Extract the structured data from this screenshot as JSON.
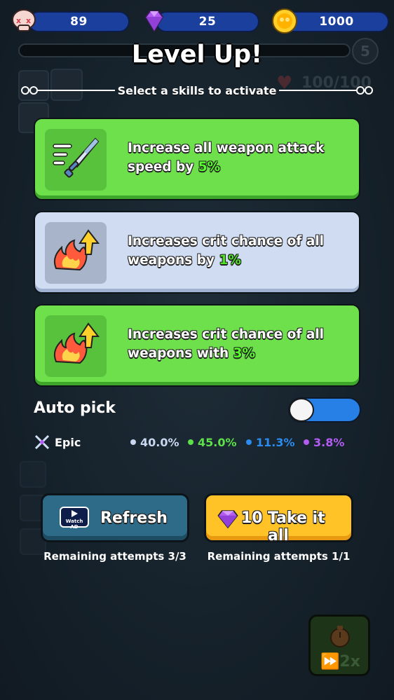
{
  "hud": {
    "kills": "89",
    "gems": "25",
    "coins": "1000",
    "level": "5",
    "hp": "100/100"
  },
  "dialog": {
    "title": "Level Up!",
    "subtitle": "Select a skills to activate"
  },
  "skills": [
    {
      "line1": "Increase all weapon attack",
      "line2_pre": "speed by ",
      "value": "5%",
      "line2_post": "",
      "style": "green",
      "icon": "sword-speed-icon"
    },
    {
      "line1": "Increases crit chance of all",
      "line2_pre": "weapons by ",
      "value": "1%",
      "line2_post": "",
      "style": "blue",
      "icon": "crit-fire-icon"
    },
    {
      "line1": "Increases crit chance of all",
      "line2_pre": "weapons with ",
      "value": "3%",
      "line2_post": "",
      "style": "green",
      "icon": "crit-fire-icon"
    }
  ],
  "auto_pick": {
    "label": "Auto pick",
    "enabled": true
  },
  "rarity": {
    "label": "Epic",
    "odds": [
      {
        "value": "40.0%",
        "color": "#c9d8f0"
      },
      {
        "value": "45.0%",
        "color": "#5ee04a"
      },
      {
        "value": "11.3%",
        "color": "#2a8cf0"
      },
      {
        "value": "3.8%",
        "color": "#b45cf2"
      }
    ]
  },
  "buttons": {
    "refresh": {
      "ad_label": "Watch AD",
      "label": "Refresh",
      "remaining": "Remaining attempts 3/3"
    },
    "take_all": {
      "cost": "10",
      "label": "Take it all",
      "remaining": "Remaining attempts 1/1"
    }
  },
  "speed": {
    "label": "2x"
  }
}
